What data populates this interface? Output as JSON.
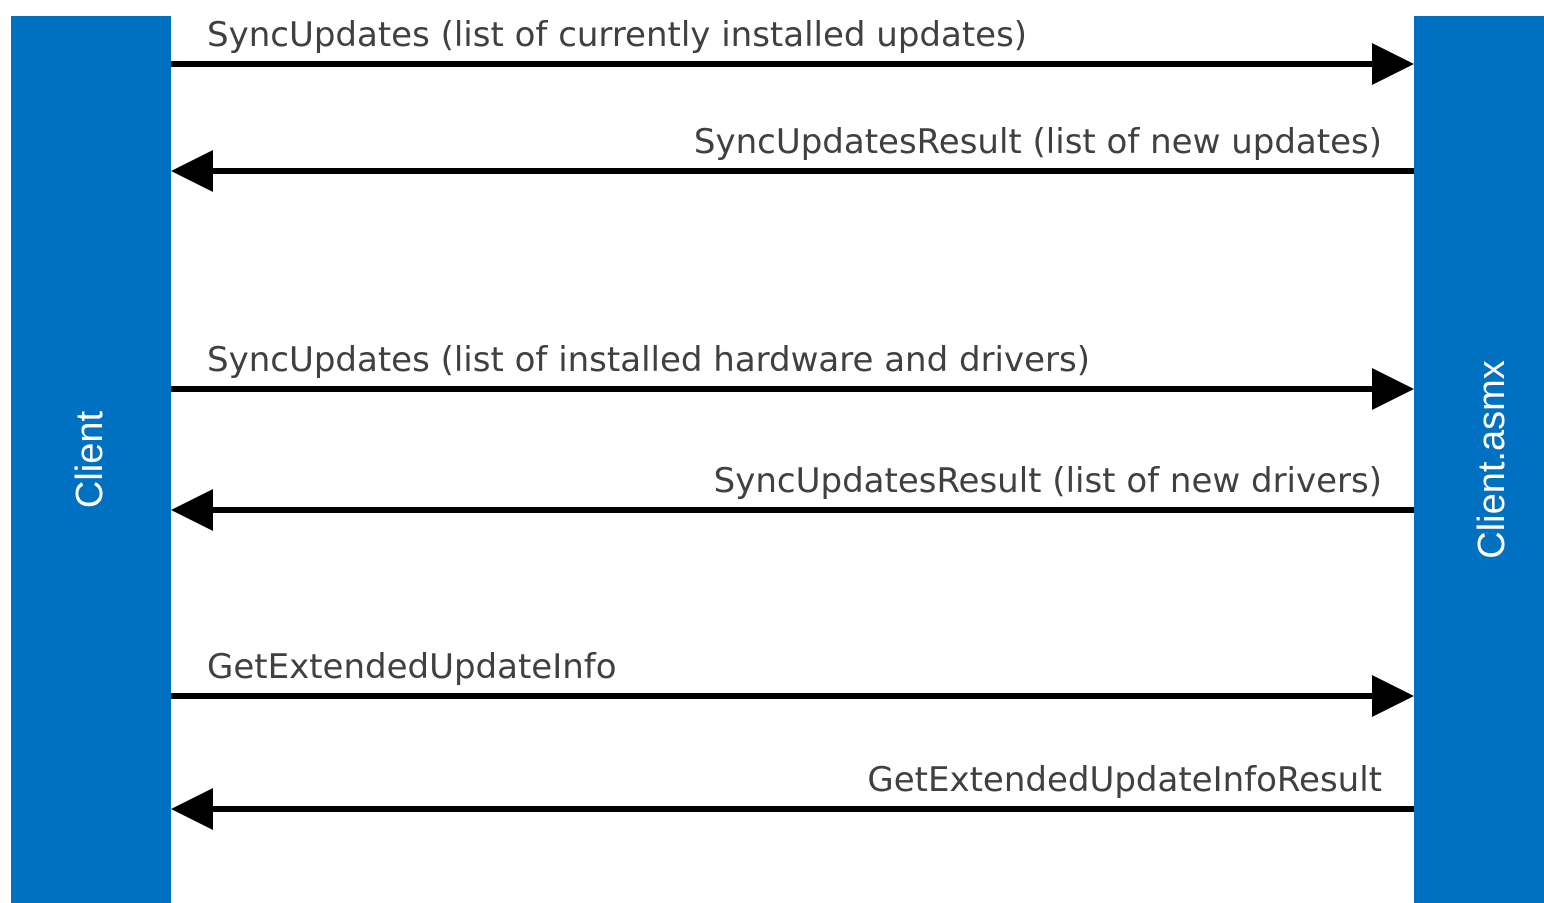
{
  "colors": {
    "lane_fill": "#0070c0",
    "lane_text": "#ffffff",
    "arrow": "#000000",
    "message_text": "#404040"
  },
  "participants": {
    "left": "Client",
    "right": "Client.asmx"
  },
  "messages": [
    {
      "label": "SyncUpdates (list of currently installed updates)",
      "direction": "left-to-right"
    },
    {
      "label": "SyncUpdatesResult (list of new updates)",
      "direction": "right-to-left"
    },
    {
      "label": "SyncUpdates (list of installed hardware and drivers)",
      "direction": "left-to-right"
    },
    {
      "label": "SyncUpdatesResult (list of new drivers)",
      "direction": "right-to-left"
    },
    {
      "label": "GetExtendedUpdateInfo",
      "direction": "left-to-right"
    },
    {
      "label": "GetExtendedUpdateInfoResult",
      "direction": "right-to-left"
    }
  ]
}
